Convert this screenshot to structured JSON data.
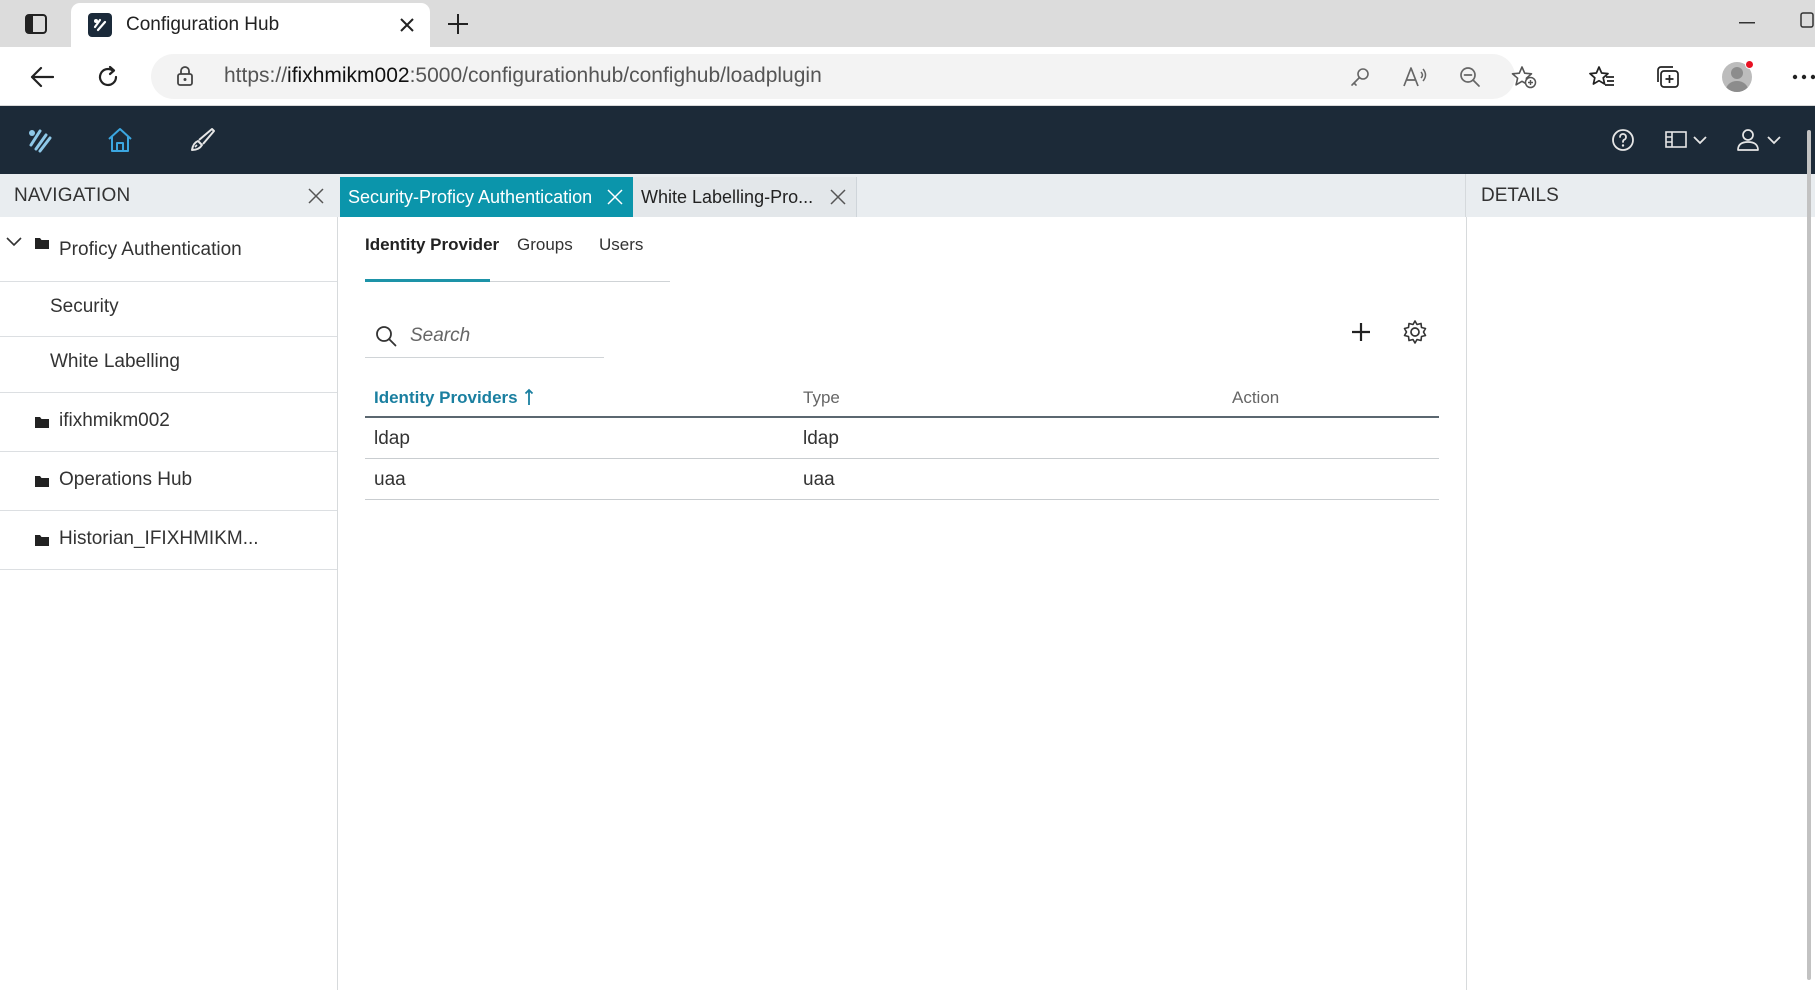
{
  "browser": {
    "tab_title": "Configuration Hub",
    "url_prefix": "https://",
    "url_host": "ifixhmikm002",
    "url_rest": ":5000/configurationhub/confighub/loadplugin"
  },
  "app_header": {
    "icons": [
      "app-logo-icon",
      "home-icon",
      "brush-icon",
      "help-icon",
      "layout-icon",
      "user-icon"
    ]
  },
  "navigation": {
    "title": "NAVIGATION",
    "items": [
      {
        "label": "Proficy Authentication",
        "icon": "folder-icon",
        "expanded": true
      },
      {
        "label": "Security"
      },
      {
        "label": "White Labelling"
      },
      {
        "label": "ifixhmikm002",
        "icon": "folder-icon"
      },
      {
        "label": "Operations Hub",
        "icon": "folder-icon"
      },
      {
        "label": "Historian_IFIXHMIKM...",
        "icon": "folder-icon"
      }
    ]
  },
  "content_tabs": [
    {
      "label": "Security-Proficy Authentication",
      "active": true
    },
    {
      "label": "White Labelling-Pro...",
      "active": false
    }
  ],
  "details": {
    "title": "DETAILS"
  },
  "subtabs": [
    {
      "label": "Identity Provider",
      "active": true
    },
    {
      "label": "Groups"
    },
    {
      "label": "Users"
    }
  ],
  "search": {
    "placeholder": "Search"
  },
  "grid": {
    "columns": [
      "Identity Providers",
      "Type",
      "Action"
    ],
    "sorted_column": "Identity Providers",
    "rows": [
      {
        "provider": "ldap",
        "type": "ldap",
        "action": ""
      },
      {
        "provider": "uaa",
        "type": "uaa",
        "action": ""
      }
    ]
  },
  "colors": {
    "accent": "#0b95ab",
    "header_bg": "#1c2a38",
    "sorted_header": "#1a7fa0"
  }
}
